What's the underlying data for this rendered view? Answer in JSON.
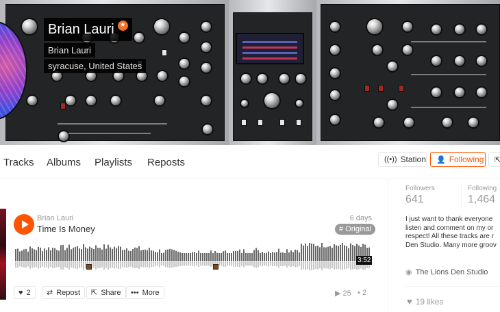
{
  "profile": {
    "name": "Brian Lauri",
    "username": "Brian Lauri",
    "location": "syracuse, United States"
  },
  "nav": {
    "tabs": [
      "Tracks",
      "Albums",
      "Playlists",
      "Reposts"
    ]
  },
  "actions": {
    "station_label": "Station",
    "following_label": "Following"
  },
  "track": {
    "user": "Brian Lauri",
    "title": "Time Is Money",
    "posted": "6 days ago",
    "tag": "# Original",
    "duration": "3:52",
    "likes": "2",
    "repost_label": "Repost",
    "share_label": "Share",
    "more_label": "More",
    "plays": "25",
    "comments": "2"
  },
  "sidebar": {
    "followers_label": "Followers",
    "followers": "641",
    "following_label": "Following",
    "following": "1,464",
    "bio_lines": [
      "I just want to thank everyone",
      "listen and comment on my or",
      "respect! All these tracks are r",
      "Den Studio. Many more groov"
    ],
    "link_text": "The Lions Den Studio",
    "likes_text": "19 likes"
  },
  "colors": {
    "accent": "#ff5500",
    "muted": "#999999",
    "tag_bg": "#999999"
  },
  "icons": [
    "pro-star-icon",
    "station-icon",
    "following-icon",
    "play-icon",
    "heart-icon",
    "repost-icon",
    "share-icon",
    "more-icon",
    "plays-icon",
    "comments-icon",
    "globe-icon"
  ]
}
